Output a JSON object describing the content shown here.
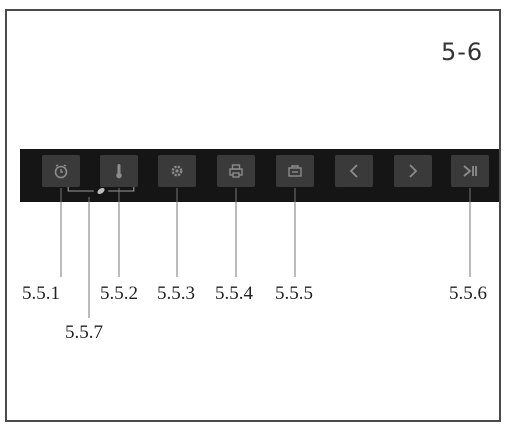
{
  "figure": {
    "label": "5-6"
  },
  "toolbar": {
    "buttons": [
      {
        "icon": "timer-icon"
      },
      {
        "icon": "thermometer-icon"
      },
      {
        "icon": "settings-icon"
      },
      {
        "icon": "print-icon"
      },
      {
        "icon": "record-icon"
      },
      {
        "icon": "chevron-left-icon"
      },
      {
        "icon": "chevron-right-icon"
      },
      {
        "icon": "skip-end-icon"
      }
    ]
  },
  "callouts": {
    "c1": "5.5.1",
    "c2": "5.5.2",
    "c3": "5.5.3",
    "c4": "5.5.4",
    "c5": "5.5.5",
    "c6": "5.5.6",
    "c7": "5.5.7"
  }
}
